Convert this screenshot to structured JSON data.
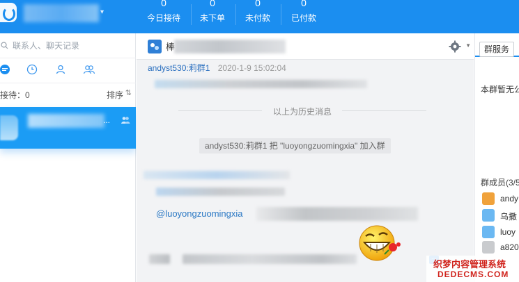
{
  "header": {
    "stats": [
      {
        "value": "0",
        "label": "今日接待"
      },
      {
        "value": "0",
        "label": "未下单"
      },
      {
        "value": "0",
        "label": "未付款"
      },
      {
        "value": "0",
        "label": "已付款"
      }
    ],
    "account_caret": "▾"
  },
  "sidebar": {
    "search_placeholder": "联系人、聊天记录",
    "waiting_label": "接待：0",
    "sort_label": "排序",
    "sort_icon": "⇅",
    "session_dots": "..."
  },
  "chat": {
    "title_initial": "棒",
    "first_sender": "andyst530:莉群1",
    "first_time": "2020-1-9 15:02:04",
    "history_divider": "以上为历史消息",
    "system_message": "andyst530:莉群1 把 \"luoyongzuomingxia\" 加入群",
    "mention_text": "@luoyongzuomingxia",
    "more_icon": "···"
  },
  "right_panel": {
    "service_tab": "群服务",
    "notice": "本群暂无公",
    "members_count": "群成员(3/5",
    "members": [
      {
        "name": "andy",
        "avatar_color": "#f0a23b"
      },
      {
        "name": "乌撒",
        "avatar_color": "#6bb8f2"
      },
      {
        "name": "luoy",
        "avatar_color": "#6bb8f2"
      },
      {
        "name": "a820",
        "avatar_color": "#c9cbce"
      }
    ]
  },
  "watermark": {
    "cn": "织梦内容管理系统",
    "en": "DEDECMS.COM"
  },
  "colors": {
    "brand_blue": "#1b8ef0",
    "session_blue": "#1b9cf5",
    "link_blue": "#2a6fbf",
    "watermark_red": "#d0231c"
  }
}
